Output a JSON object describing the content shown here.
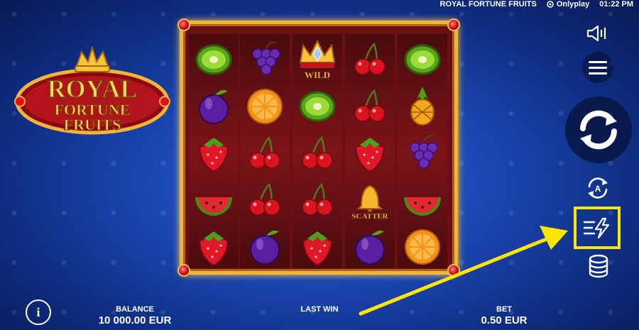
{
  "topbar": {
    "game_title": "ROYAL FORTUNE FRUITS",
    "provider": "Onlyplay",
    "time": "01:22 PM"
  },
  "logo": {
    "line1": "ROYAL",
    "line2": "FORTUNE",
    "line3": "FRUITS"
  },
  "reels": [
    [
      "kiwi",
      "plum",
      "strawberry",
      "watermelon",
      "strawberry"
    ],
    [
      "grapes",
      "orange",
      "cherry",
      "cherry",
      "plum"
    ],
    [
      "wild",
      "kiwi",
      "cherry",
      "cherry",
      "strawberry"
    ],
    [
      "cherry",
      "cherry",
      "strawberry",
      "scatter",
      "plum"
    ],
    [
      "kiwi",
      "pineapple",
      "grapes",
      "watermelon",
      "orange"
    ]
  ],
  "symbols": {
    "wild_label": "WILD",
    "scatter_label": "SCATTER"
  },
  "controls": {
    "sound_icon": "speaker-icon",
    "menu_icon": "hamburger-icon",
    "spin_icon": "spin-arrows-icon",
    "autoplay_icon": "autoplay-icon",
    "autoplay_letter": "A",
    "turbo_icon": "turbo-lightning-icon",
    "bet_icon": "coins-stack-icon",
    "info_icon": "info-icon",
    "info_letter": "i"
  },
  "footer": {
    "balance_label": "BALANCE",
    "balance_value": "10 000.00 EUR",
    "lastwin_label": "LAST WIN",
    "bet_label": "BET",
    "bet_value": "0.50 EUR"
  },
  "colors": {
    "highlight": "#ffe600",
    "frame_gold": "#f1b43a"
  }
}
